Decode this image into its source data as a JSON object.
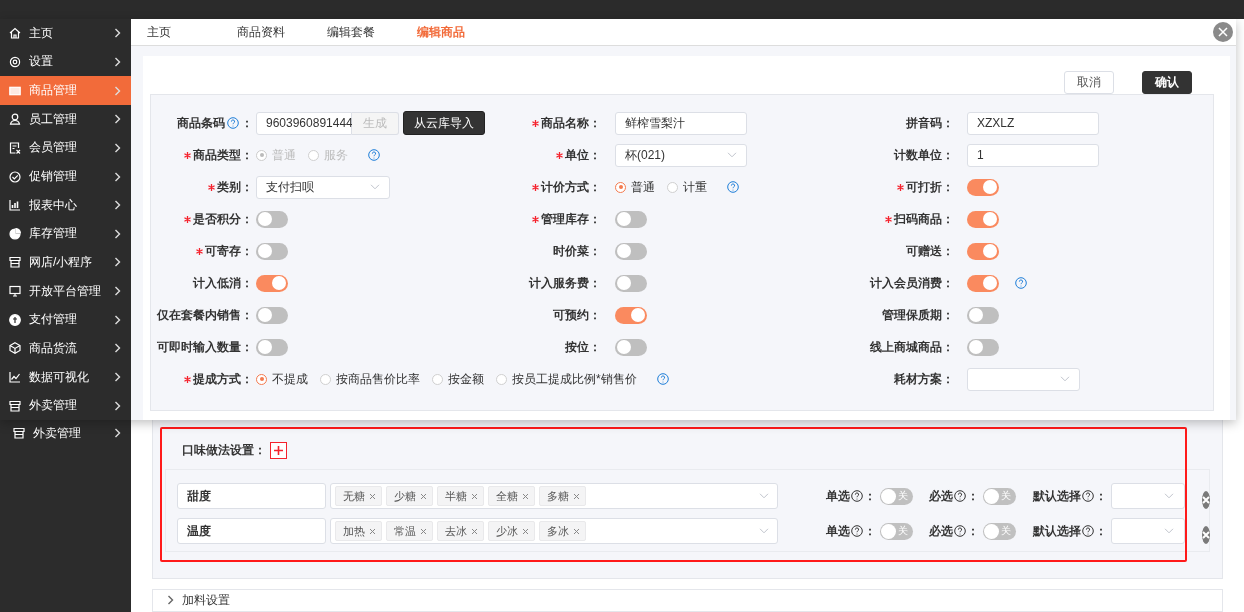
{
  "sidebar": {
    "items": [
      {
        "label": "主页",
        "selected": false
      },
      {
        "label": "设置",
        "selected": false
      },
      {
        "label": "商品管理",
        "selected": true
      },
      {
        "label": "员工管理",
        "selected": false
      },
      {
        "label": "会员管理",
        "selected": false
      },
      {
        "label": "促销管理",
        "selected": false
      },
      {
        "label": "报表中心",
        "selected": false
      },
      {
        "label": "库存管理",
        "selected": false
      },
      {
        "label": "网店/小程序",
        "selected": false
      },
      {
        "label": "开放平台管理",
        "selected": false
      },
      {
        "label": "支付管理",
        "selected": false
      },
      {
        "label": "商品货流",
        "selected": false
      },
      {
        "label": "数据可视化",
        "selected": false
      },
      {
        "label": "外卖管理",
        "selected": false
      }
    ]
  },
  "tabs": [
    {
      "label": "主页",
      "selected": false
    },
    {
      "label": "商品资料",
      "selected": false
    },
    {
      "label": "编辑套餐",
      "selected": false
    },
    {
      "label": "编辑商品",
      "selected": true
    }
  ],
  "actions": {
    "cancel": "取消",
    "confirm": "确认"
  },
  "form": {
    "rows": [
      [
        {
          "kind": "barcode",
          "label": "商品条码",
          "label_suffix": "：",
          "required": false,
          "help_in_label": true,
          "value": "9603960891444",
          "generate": {
            "label": "生成",
            "disabled": true
          },
          "import": "从云库导入"
        },
        {
          "kind": "input",
          "label": "商品名称：",
          "required": true,
          "value": "鲜榨雪梨汁"
        },
        {
          "kind": "input",
          "label": "拼音码：",
          "required": false,
          "value": "XZXLZ"
        }
      ],
      [
        {
          "kind": "radio",
          "label": "商品类型：",
          "required": true,
          "disabled": true,
          "help_after": true,
          "options": [
            {
              "label": "普通",
              "selected": true
            },
            {
              "label": "服务",
              "selected": false
            }
          ]
        },
        {
          "kind": "select",
          "label": "单位：",
          "required": true,
          "value": "杯(021)"
        },
        {
          "kind": "input",
          "label": "计数单位：",
          "required": false,
          "value": "1"
        }
      ],
      [
        {
          "kind": "select",
          "label": "类别：",
          "required": true,
          "value": "支付扫呗"
        },
        {
          "kind": "radio",
          "label": "计价方式：",
          "required": true,
          "disabled": false,
          "help_after": true,
          "options": [
            {
              "label": "普通",
              "selected": true
            },
            {
              "label": "计重",
              "selected": false
            }
          ]
        },
        {
          "kind": "toggle",
          "label": "可打折：",
          "required": true,
          "on": true
        }
      ],
      [
        {
          "kind": "toggle",
          "label": "是否积分：",
          "required": true,
          "on": false
        },
        {
          "kind": "toggle",
          "label": "管理库存：",
          "required": true,
          "on": false
        },
        {
          "kind": "toggle",
          "label": "扫码商品：",
          "required": true,
          "on": true
        }
      ],
      [
        {
          "kind": "toggle",
          "label": "可寄存：",
          "required": true,
          "on": false
        },
        {
          "kind": "toggle",
          "label": "时价菜：",
          "required": false,
          "on": false
        },
        {
          "kind": "toggle",
          "label": "可赠送：",
          "required": false,
          "on": true
        }
      ],
      [
        {
          "kind": "toggle",
          "label": "计入低消：",
          "required": false,
          "on": true
        },
        {
          "kind": "toggle",
          "label": "计入服务费：",
          "required": false,
          "on": false
        },
        {
          "kind": "toggle",
          "label": "计入会员消费：",
          "required": false,
          "on": true,
          "help_after": true
        }
      ],
      [
        {
          "kind": "toggle",
          "label": "仅在套餐内销售：",
          "required": false,
          "on": false
        },
        {
          "kind": "toggle",
          "label": "可预约：",
          "required": false,
          "on": true
        },
        {
          "kind": "toggle",
          "label": "管理保质期：",
          "required": false,
          "on": false
        }
      ],
      [
        {
          "kind": "toggle",
          "label": "可即时输入数量：",
          "required": false,
          "on": false
        },
        {
          "kind": "toggle",
          "label": "按位：",
          "required": false,
          "on": false
        },
        {
          "kind": "toggle",
          "label": "线上商城商品：",
          "required": false,
          "on": false
        }
      ],
      [
        {
          "kind": "radio",
          "label": "提成方式：",
          "required": true,
          "disabled": false,
          "help_after": true,
          "options": [
            {
              "label": "不提成",
              "selected": true
            },
            {
              "label": "按商品售价比率",
              "selected": false
            },
            {
              "label": "按金额",
              "selected": false
            },
            {
              "label": "按员工提成比例*销售价",
              "selected": false
            }
          ]
        },
        "",
        {
          "kind": "select",
          "label": "耗材方案：",
          "required": false
        }
      ]
    ]
  },
  "background": {
    "sidebar_items": [
      {
        "label": "外卖管理"
      }
    ],
    "flavor_section": {
      "title": "口味做法设置：",
      "rows": [
        {
          "name": "甜度",
          "tags": [
            "无糖",
            "少糖",
            "半糖",
            "全糖",
            "多糖"
          ],
          "switches": [
            {
              "label": "单选",
              "suffix": "：",
              "on": false,
              "text": "关"
            },
            {
              "label": "必选",
              "suffix": "：",
              "on": false,
              "text": "关"
            }
          ],
          "default": {
            "label": "默认选择",
            "suffix": "："
          }
        },
        {
          "name": "温度",
          "tags": [
            "加热",
            "常温",
            "去冰",
            "少冰",
            "多冰"
          ],
          "switches": [
            {
              "label": "单选",
              "suffix": "：",
              "on": false,
              "text": "关"
            },
            {
              "label": "必选",
              "suffix": "：",
              "on": false,
              "text": "关"
            }
          ],
          "default": {
            "label": "默认选择",
            "suffix": "："
          }
        }
      ]
    },
    "topping_section": {
      "title": "加料设置"
    }
  }
}
